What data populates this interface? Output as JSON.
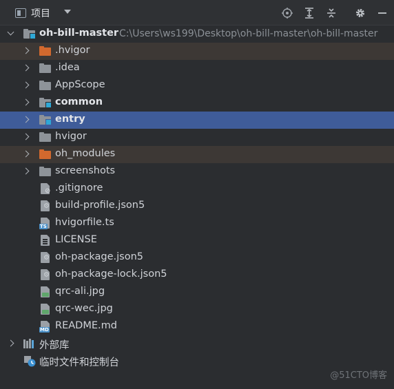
{
  "toolbar": {
    "title": "项目",
    "icons": [
      "project-view-icon",
      "chevron-down-icon",
      "locate-icon",
      "expand-all-icon",
      "collapse-all-icon",
      "gear-icon",
      "minimize-icon"
    ]
  },
  "root": {
    "name": "oh-bill-master",
    "path": "C:\\Users\\ws199\\Desktop\\oh-bill-master\\oh-bill-master"
  },
  "items": [
    {
      "name": ".hvigor",
      "kind": "folder-orange"
    },
    {
      "name": ".idea",
      "kind": "folder"
    },
    {
      "name": "AppScope",
      "kind": "folder"
    },
    {
      "name": "common",
      "kind": "module"
    },
    {
      "name": "entry",
      "kind": "module"
    },
    {
      "name": "hvigor",
      "kind": "folder"
    },
    {
      "name": "oh_modules",
      "kind": "folder-orange"
    },
    {
      "name": "screenshots",
      "kind": "folder"
    },
    {
      "name": ".gitignore",
      "kind": "file"
    },
    {
      "name": "build-profile.json5",
      "kind": "json5"
    },
    {
      "name": "hvigorfile.ts",
      "kind": "ts"
    },
    {
      "name": "LICENSE",
      "kind": "text"
    },
    {
      "name": "oh-package.json5",
      "kind": "json5"
    },
    {
      "name": "oh-package-lock.json5",
      "kind": "json5"
    },
    {
      "name": "qrc-ali.jpg",
      "kind": "image"
    },
    {
      "name": "qrc-wec.jpg",
      "kind": "image"
    },
    {
      "name": "README.md",
      "kind": "md"
    }
  ],
  "external_libraries": "外部库",
  "scratches": "临时文件和控制台",
  "watermark": "@51CTO博客",
  "colors": {
    "selected_row": "#3f5c99",
    "excluded_row": "#3d3835",
    "orange_folder": "#d2692e",
    "module_marker": "#2fa8d6"
  }
}
